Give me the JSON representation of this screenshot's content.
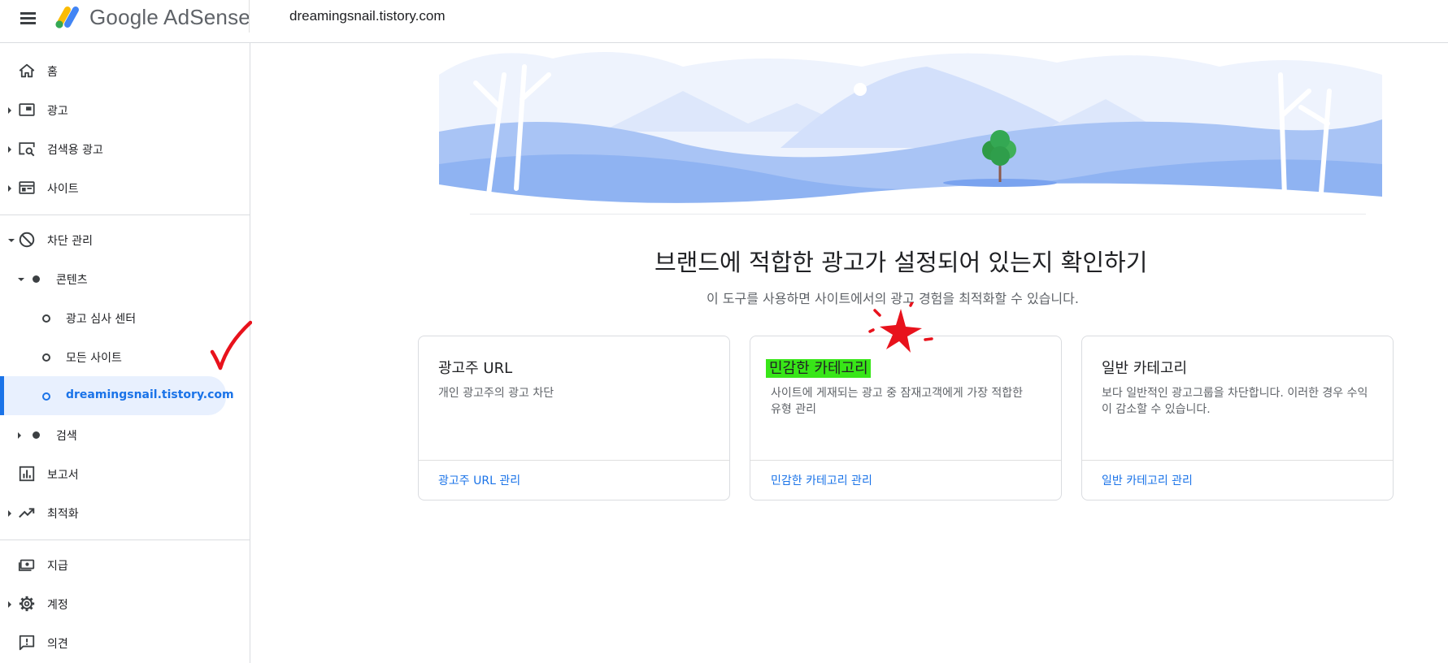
{
  "header": {
    "brand": "Google AdSense",
    "site": "dreamingsnail.tistory.com",
    "logo_colors": [
      "#fbbc04",
      "#34a853",
      "#4285f4"
    ]
  },
  "sidebar": {
    "items": [
      {
        "label": "홈",
        "icon": "home-icon"
      },
      {
        "label": "광고",
        "icon": "ads-icon"
      },
      {
        "label": "검색용 광고",
        "icon": "search-ads-icon"
      },
      {
        "label": "사이트",
        "icon": "sites-icon"
      },
      {
        "label": "차단 관리",
        "icon": "block-icon"
      },
      {
        "label": "콘텐츠",
        "icon": "dot-icon"
      },
      {
        "label": "광고 심사 센터",
        "icon": "ring-icon"
      },
      {
        "label": "모든 사이트",
        "icon": "ring-icon"
      },
      {
        "label": "dreamingsnail.tistory.com",
        "icon": "ring-icon",
        "active": true
      },
      {
        "label": "검색",
        "icon": "dot-icon"
      },
      {
        "label": "보고서",
        "icon": "bar-chart-icon"
      },
      {
        "label": "최적화",
        "icon": "trending-up-icon"
      },
      {
        "label": "지급",
        "icon": "payments-icon"
      },
      {
        "label": "계정",
        "icon": "gear-icon"
      },
      {
        "label": "의견",
        "icon": "feedback-icon"
      }
    ]
  },
  "main": {
    "title": "브랜드에 적합한 광고가 설정되어 있는지 확인하기",
    "subtitle": "이 도구를 사용하면 사이트에서의 광고 경험을 최적화할 수 있습니다.",
    "cards": [
      {
        "title": "광고주 URL",
        "description": "개인 광고주의 광고 차단",
        "link": "광고주 URL 관리"
      },
      {
        "title": "민감한 카테고리",
        "description": "사이트에 게재되는 광고 중 잠재고객에게 가장 적합한 유형 관리",
        "link": "민감한 카테고리 관리",
        "highlighted": true
      },
      {
        "title": "일반 카테고리",
        "description": "보다 일반적인 광고그룹을 차단합니다. 이러한 경우 수익이 감소할 수 있습니다.",
        "link": "일반 카테고리 관리"
      }
    ]
  },
  "colors": {
    "accent": "#1a73e8",
    "active_bg": "#e8f0fe",
    "highlight": "#38e618",
    "annotation": "#e8121c"
  }
}
